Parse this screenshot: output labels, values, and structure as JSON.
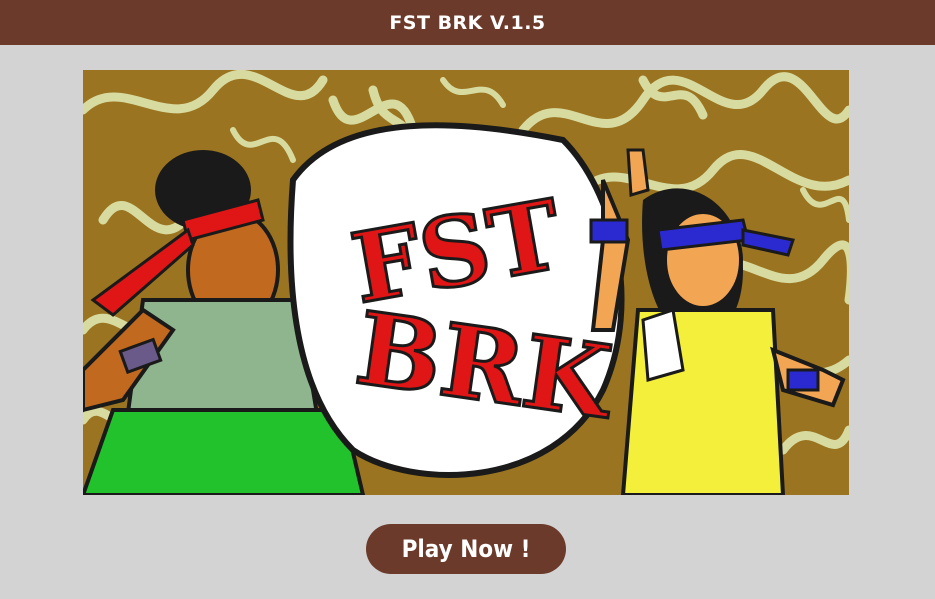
{
  "header": {
    "title": "FST BRK V.1.5"
  },
  "artwork": {
    "logo_text_top": "FST",
    "logo_text_bottom": "BRK"
  },
  "actions": {
    "play_label": "Play Now !"
  },
  "colors": {
    "header_bg": "#6b3a2a",
    "page_bg": "#d3d3d3",
    "art_bg": "#9a7420",
    "graffiti": "#d8dba0",
    "logo_red": "#e01515"
  }
}
